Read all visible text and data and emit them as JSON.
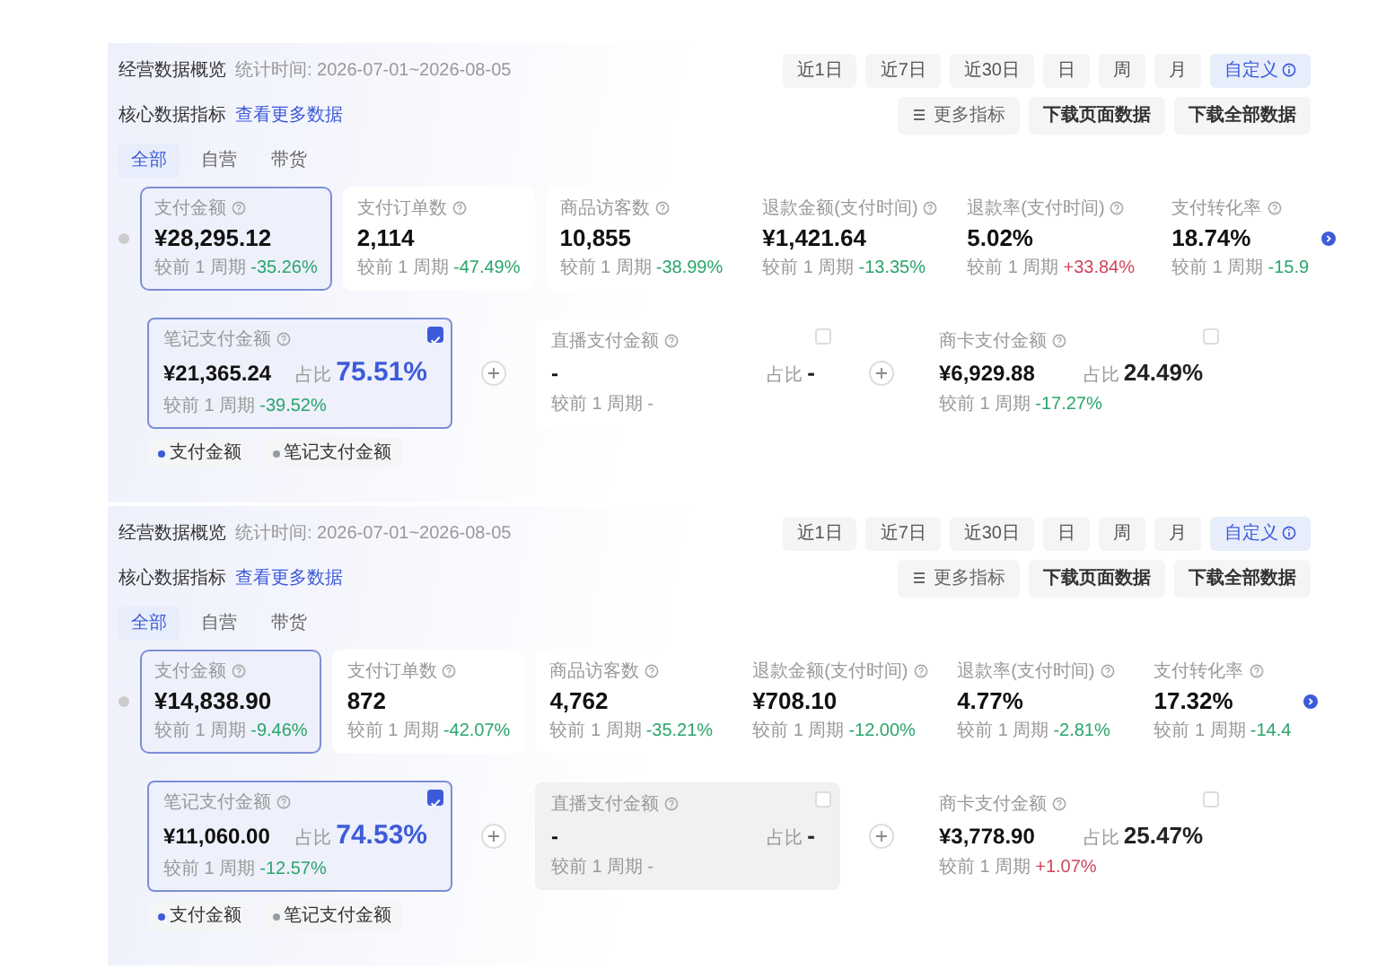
{
  "panels": [
    {
      "title": "经营数据概览",
      "stat_time": "统计时间: 2026-07-01~2026-08-05",
      "ranges": [
        {
          "label": "近1日",
          "selected": false
        },
        {
          "label": "近7日",
          "selected": false
        },
        {
          "label": "近30日",
          "selected": false
        },
        {
          "label": "日",
          "selected": false
        },
        {
          "label": "周",
          "selected": false
        },
        {
          "label": "月",
          "selected": false
        },
        {
          "label": "自定义",
          "selected": true
        }
      ],
      "section_title": "核心数据指标",
      "more_link": "查看更多数据",
      "actions": [
        "更多指标",
        "下载页面数据",
        "下载全部数据"
      ],
      "filters": [
        {
          "label": "全部",
          "selected": true
        },
        {
          "label": "自营",
          "selected": false
        },
        {
          "label": "带货",
          "selected": false
        }
      ],
      "metrics": [
        {
          "label": "支付金额",
          "value": "¥28,295.12",
          "compare": "较前 1 周期",
          "change": "-35.26%",
          "color": "#2aa56a",
          "selected": true
        },
        {
          "label": "支付订单数",
          "value": "2,114",
          "compare": "较前 1 周期",
          "change": "-47.49%",
          "color": "#2aa56a",
          "selected": false
        },
        {
          "label": "商品访客数",
          "value": "10,855",
          "compare": "较前 1 周期",
          "change": "-38.99%",
          "color": "#2aa56a",
          "selected": false
        },
        {
          "label": "退款金额(支付时间)",
          "value": "¥1,421.64",
          "compare": "较前 1 周期",
          "change": "-13.35%",
          "color": "#2aa56a",
          "selected": false
        },
        {
          "label": "退款率(支付时间)",
          "value": "5.02%",
          "compare": "较前 1 周期",
          "change": "+33.84%",
          "color": "#d0455a",
          "selected": false
        },
        {
          "label": "支付转化率",
          "value": "18.74%",
          "compare": "较前 1 周期",
          "change": "-15.9",
          "color": "#2aa56a",
          "selected": false
        }
      ],
      "breakdown": [
        {
          "label": "笔记支付金额",
          "value": "¥21,365.24",
          "share_label": "占比",
          "share": "75.51%",
          "compare": "较前 1 周期",
          "change": "-39.52%",
          "color": "#2aa56a",
          "checked": true,
          "disabled": false
        },
        {
          "label": "直播支付金额",
          "value": "-",
          "share_label": "占比",
          "share": "-",
          "compare": "较前 1 周期",
          "change": "-",
          "color": "#999999",
          "checked": false,
          "disabled": false
        },
        {
          "label": "商卡支付金额",
          "value": "¥6,929.88",
          "share_label": "占比",
          "share": "24.49%",
          "compare": "较前 1 周期",
          "change": "-17.27%",
          "color": "#2aa56a",
          "checked": false,
          "disabled": false
        }
      ],
      "legend": [
        {
          "label": "支付金额",
          "color": "#3d5bd9"
        },
        {
          "label": "笔记支付金额",
          "color": "#9a9ca3"
        }
      ]
    },
    {
      "title": "经营数据概览",
      "stat_time": "统计时间: 2026-07-01~2026-08-05",
      "ranges": [
        {
          "label": "近1日",
          "selected": false
        },
        {
          "label": "近7日",
          "selected": false
        },
        {
          "label": "近30日",
          "selected": false
        },
        {
          "label": "日",
          "selected": false
        },
        {
          "label": "周",
          "selected": false
        },
        {
          "label": "月",
          "selected": false
        },
        {
          "label": "自定义",
          "selected": true
        }
      ],
      "section_title": "核心数据指标",
      "more_link": "查看更多数据",
      "actions": [
        "更多指标",
        "下载页面数据",
        "下载全部数据"
      ],
      "filters": [
        {
          "label": "全部",
          "selected": true
        },
        {
          "label": "自营",
          "selected": false
        },
        {
          "label": "带货",
          "selected": false
        }
      ],
      "metrics": [
        {
          "label": "支付金额",
          "value": "¥14,838.90",
          "compare": "较前 1 周期",
          "change": "-9.46%",
          "color": "#2aa56a",
          "selected": true
        },
        {
          "label": "支付订单数",
          "value": "872",
          "compare": "较前 1 周期",
          "change": "-42.07%",
          "color": "#2aa56a",
          "selected": false
        },
        {
          "label": "商品访客数",
          "value": "4,762",
          "compare": "较前 1 周期",
          "change": "-35.21%",
          "color": "#2aa56a",
          "selected": false
        },
        {
          "label": "退款金额(支付时间)",
          "value": "¥708.10",
          "compare": "较前 1 周期",
          "change": "-12.00%",
          "color": "#2aa56a",
          "selected": false
        },
        {
          "label": "退款率(支付时间)",
          "value": "4.77%",
          "compare": "较前 1 周期",
          "change": "-2.81%",
          "color": "#2aa56a",
          "selected": false
        },
        {
          "label": "支付转化率",
          "value": "17.32%",
          "compare": "较前 1 周期",
          "change": "-14.4",
          "color": "#2aa56a",
          "selected": false
        }
      ],
      "breakdown": [
        {
          "label": "笔记支付金额",
          "value": "¥11,060.00",
          "share_label": "占比",
          "share": "74.53%",
          "compare": "较前 1 周期",
          "change": "-12.57%",
          "color": "#2aa56a",
          "checked": true,
          "disabled": false
        },
        {
          "label": "直播支付金额",
          "value": "-",
          "share_label": "占比",
          "share": "-",
          "compare": "较前 1 周期",
          "change": "-",
          "color": "#999999",
          "checked": false,
          "disabled": true
        },
        {
          "label": "商卡支付金额",
          "value": "¥3,778.90",
          "share_label": "占比",
          "share": "25.47%",
          "compare": "较前 1 周期",
          "change": "+1.07%",
          "color": "#d0455a",
          "checked": false,
          "disabled": false
        }
      ],
      "legend": [
        {
          "label": "支付金额",
          "color": "#3d5bd9"
        },
        {
          "label": "笔记支付金额",
          "color": "#9a9ca3"
        }
      ]
    }
  ]
}
